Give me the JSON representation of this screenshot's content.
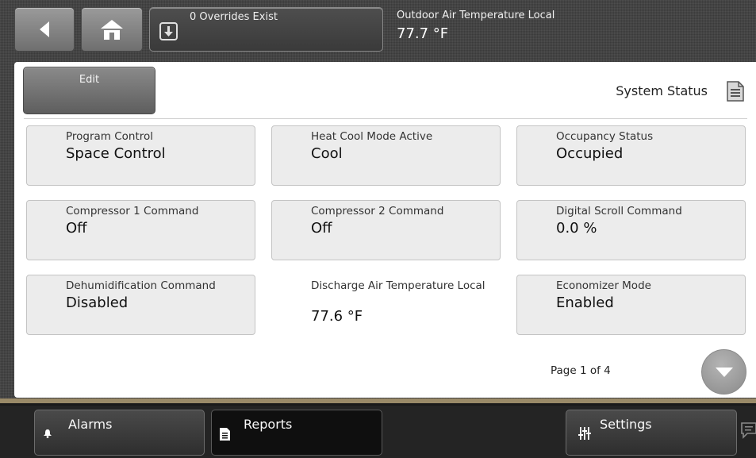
{
  "header": {
    "overrides_text": "0 Overrides Exist",
    "oat_label": "Outdoor Air Temperature Local",
    "oat_value": "77.7 °F"
  },
  "panel": {
    "edit_label": "Edit",
    "title": "System Status",
    "tiles": [
      {
        "label": "Program Control",
        "value": "Space Control"
      },
      {
        "label": "Heat Cool Mode Active",
        "value": "Cool"
      },
      {
        "label": "Occupancy Status",
        "value": "Occupied"
      },
      {
        "label": "Compressor 1 Command",
        "value": "Off"
      },
      {
        "label": "Compressor 2 Command",
        "value": "Off"
      },
      {
        "label": "Digital Scroll Command",
        "value": "0.0 %"
      },
      {
        "label": "Dehumidification Command",
        "value": "Disabled"
      },
      {
        "label": "Discharge Air Temperature Local",
        "value": "77.6 °F"
      },
      {
        "label": "Economizer Mode",
        "value": "Enabled"
      }
    ],
    "page_text": "Page 1 of 4"
  },
  "bottom_nav": {
    "alarms": "Alarms",
    "reports": "Reports",
    "settings": "Settings"
  },
  "icons": {
    "back": "back-arrow-icon",
    "home": "home-icon",
    "override": "download-arrow-icon",
    "document": "document-icon",
    "page_down": "chevron-down-icon",
    "alarm": "bell-icon",
    "report": "document-icon",
    "settings": "sliders-icon",
    "chat": "chat-icon"
  },
  "colors": {
    "background": "#3a3a3a",
    "panel": "#ffffff",
    "tile": "#ececec",
    "accent_rule": "#9a8a68"
  }
}
